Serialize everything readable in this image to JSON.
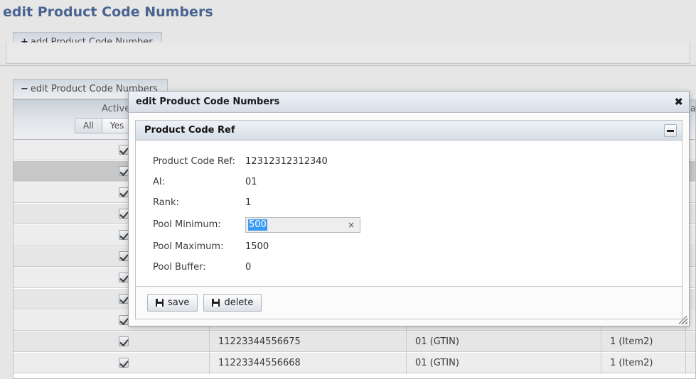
{
  "page": {
    "title": "edit Product Code Numbers",
    "title_color": "#4a6491",
    "background_color": "#e6e6e6"
  },
  "panels": [
    {
      "icon": "plus-icon",
      "icon_glyph": "+",
      "label": "add Product Code Number"
    },
    {
      "icon": "minus-icon",
      "icon_glyph": "−",
      "label": "edit Product Code Numbers"
    }
  ],
  "grid": {
    "columns": [
      {
        "label": "Active"
      },
      {
        "label": ""
      },
      {
        "label": ""
      },
      {
        "label": "a"
      }
    ],
    "filters": [
      {
        "label": "All",
        "active": true
      },
      {
        "label": "Yes",
        "active": false
      }
    ],
    "rows": [
      {
        "active": true,
        "code": "",
        "ai": "",
        "rank": "",
        "selected": false
      },
      {
        "active": true,
        "code": "",
        "ai": "",
        "rank": "",
        "selected": true
      },
      {
        "active": true,
        "code": "",
        "ai": "",
        "rank": "",
        "selected": false
      },
      {
        "active": true,
        "code": "",
        "ai": "",
        "rank": "",
        "selected": false
      },
      {
        "active": true,
        "code": "",
        "ai": "",
        "rank": "",
        "selected": false
      },
      {
        "active": true,
        "code": "",
        "ai": "",
        "rank": "",
        "selected": false
      },
      {
        "active": true,
        "code": "",
        "ai": "",
        "rank": "",
        "selected": false
      },
      {
        "active": true,
        "code": "",
        "ai": "",
        "rank": "",
        "selected": false
      },
      {
        "active": true,
        "code": "",
        "ai": "",
        "rank": "",
        "selected": false
      },
      {
        "active": true,
        "code": "11223344556675",
        "ai": "01 (GTIN)",
        "rank": "1 (Item2)",
        "selected": false
      },
      {
        "active": true,
        "code": "11223344556668",
        "ai": "01 (GTIN)",
        "rank": "1 (Item2)",
        "selected": false
      }
    ]
  },
  "dialog": {
    "title": "edit Product Code Numbers",
    "close_icon": "✖",
    "fieldset": {
      "legend": "Product Code Ref",
      "collapse_icon": "minimize-icon"
    },
    "fields": [
      {
        "label": "Product Code Ref:",
        "value": "12312312312340",
        "type": "static"
      },
      {
        "label": "AI:",
        "value": "01",
        "type": "static"
      },
      {
        "label": "Rank:",
        "value": "1",
        "type": "static"
      },
      {
        "label": "Pool Minimum:",
        "value": "500",
        "type": "input",
        "selected": true,
        "clear_icon": "×"
      },
      {
        "label": "Pool Maximum:",
        "value": "1500",
        "type": "static"
      },
      {
        "label": "Pool Buffer:",
        "value": "0",
        "type": "static"
      }
    ],
    "buttons": [
      {
        "label": "save",
        "icon": "save-icon"
      },
      {
        "label": "delete",
        "icon": "save-icon"
      }
    ],
    "selection_color": "#3b9bf0"
  }
}
